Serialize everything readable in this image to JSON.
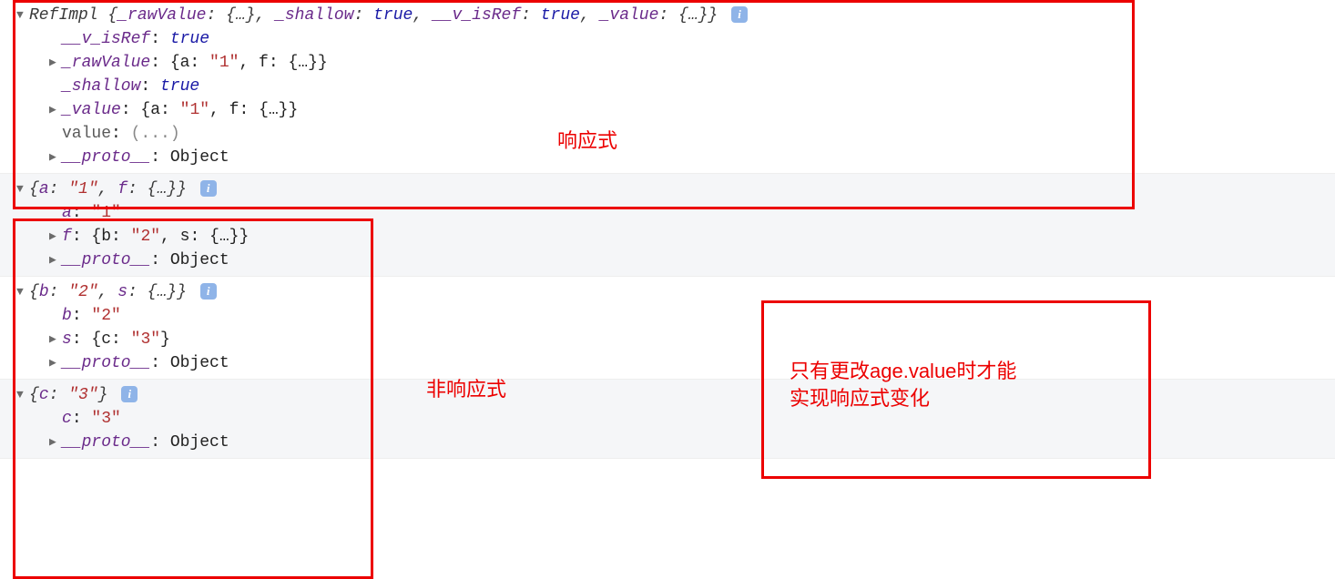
{
  "row1": {
    "summary": {
      "className": "RefImpl",
      "rawValue": "{…}",
      "shallow": "true",
      "v_isRef": "true",
      "value": "{…}"
    },
    "props": {
      "v_isRef_key": "__v_isRef",
      "v_isRef_val": "true",
      "rawValue_key": "_rawValue",
      "rawValue_val_a": "\"1\"",
      "rawValue_val_f": "{…}",
      "shallow_key": "_shallow",
      "shallow_val": "true",
      "value_key": "_value",
      "value_val_a": "\"1\"",
      "value_val_f": "{…}",
      "getter_key": "value",
      "getter_val": "(...)",
      "proto_key": "__proto__",
      "proto_val": "Object"
    }
  },
  "row2": {
    "summary_a": "\"1\"",
    "summary_f": "{…}",
    "a_key": "a",
    "a_val": "\"1\"",
    "f_key": "f",
    "f_b_val": "\"2\"",
    "f_s_val": "{…}",
    "proto_key": "__proto__",
    "proto_val": "Object"
  },
  "row3": {
    "summary_b": "\"2\"",
    "summary_s": "{…}",
    "b_key": "b",
    "b_val": "\"2\"",
    "s_key": "s",
    "s_c_val": "\"3\"",
    "proto_key": "__proto__",
    "proto_val": "Object"
  },
  "row4": {
    "summary_c": "\"3\"",
    "c_key": "c",
    "c_val": "\"3\"",
    "proto_key": "__proto__",
    "proto_val": "Object"
  },
  "annotations": {
    "reactive": "响应式",
    "non_reactive": "非响应式",
    "note_line1": "只有更改age.value时才能",
    "note_line2": "实现响应式变化"
  },
  "common": {
    "a_label": "a",
    "f_label": "f",
    "b_label": "b",
    "s_label": "s",
    "c_label": "c"
  }
}
